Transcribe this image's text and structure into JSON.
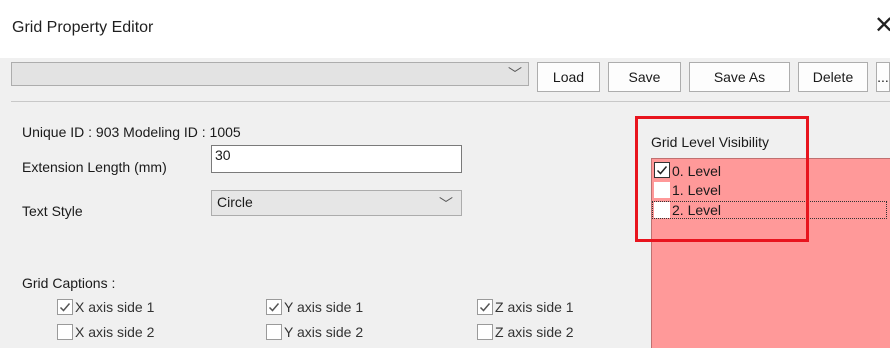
{
  "window": {
    "title": "Grid Property Editor",
    "close_glyph": "✕"
  },
  "toolbar": {
    "combo_value": "",
    "combo_arrow": "﹀",
    "buttons": [
      "Load",
      "Save",
      "Save As",
      "Delete",
      "..."
    ]
  },
  "info": {
    "ids": "Unique ID : 903   Modeling ID : 1005"
  },
  "form": {
    "extension_label": "Extension Length (mm)",
    "extension_value": "30",
    "text_style_label": "Text Style",
    "text_style_value": "Circle",
    "text_style_arrow": "﹀"
  },
  "captions": {
    "label": "Grid Captions :",
    "items": [
      {
        "label": "X axis side 1",
        "checked": true
      },
      {
        "label": "X axis side 2",
        "checked": false
      },
      {
        "label": "Y axis side 1",
        "checked": true
      },
      {
        "label": "Y axis side 2",
        "checked": false
      },
      {
        "label": "Z axis side 1",
        "checked": true
      },
      {
        "label": "Z axis side 2",
        "checked": false
      }
    ]
  },
  "visibility": {
    "label": "Grid Level Visibility",
    "levels": [
      {
        "label": "0. Level",
        "checked": true
      },
      {
        "label": "1. Level",
        "checked": false
      },
      {
        "label": "2. Level",
        "checked": false
      }
    ],
    "highlight_color": "#e8141e",
    "list_color": "#ff9999"
  }
}
